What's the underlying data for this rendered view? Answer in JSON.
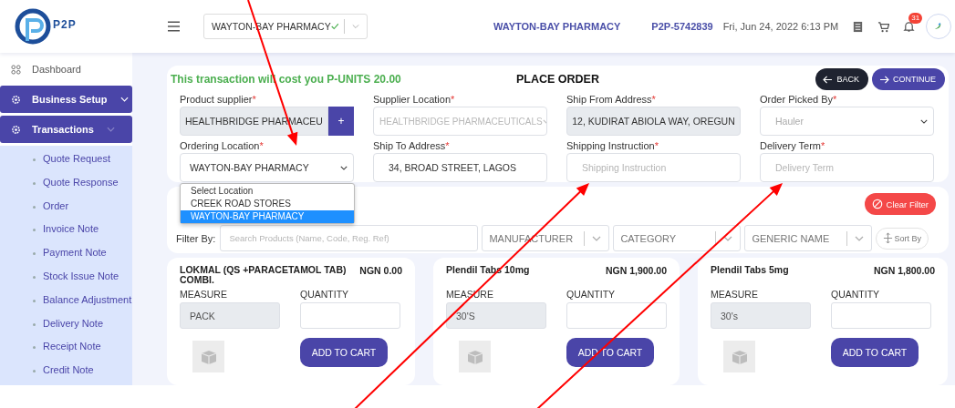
{
  "header": {
    "logo_text": "P2P",
    "store_select": {
      "value": "WAYTON-BAY PHARMACY",
      "verified": true
    },
    "org_name": "WAYTON-BAY PHARMACY",
    "account_id": "P2P-5742839",
    "datetime": "Fri, Jun 24, 2022 6:13 PM",
    "notification_count": "31"
  },
  "sidebar": {
    "items": [
      {
        "kind": "link",
        "label": "Dashboard"
      },
      {
        "kind": "group",
        "label": "Business Setup",
        "expanded": false
      },
      {
        "kind": "group",
        "label": "Transactions",
        "expanded": true,
        "children": [
          {
            "label": "Quote Request"
          },
          {
            "label": "Quote Response"
          },
          {
            "label": "Order"
          },
          {
            "label": "Invoice Note"
          },
          {
            "label": "Payment Note"
          },
          {
            "label": "Stock Issue Note"
          },
          {
            "label": "Balance Adjustment"
          },
          {
            "label": "Delivery Note"
          },
          {
            "label": "Receipt Note"
          },
          {
            "label": "Credit Note"
          }
        ]
      }
    ]
  },
  "order_form": {
    "required_mark": "*",
    "cost_notice": "This transaction will cost you P-UNITS 20.00",
    "title": "PLACE ORDER",
    "buttons": [
      {
        "kind": "back",
        "label": "BACK"
      },
      {
        "kind": "continue",
        "label": "CONTINUE"
      }
    ],
    "fields": [
      {
        "label": "Product supplier",
        "required": true,
        "kind": "readonly",
        "value": "HEALTHBRIDGE PHARMACEU",
        "add_button": "+"
      },
      {
        "label": "Supplier Location",
        "required": true,
        "kind": "select",
        "value": "HEALTHBRIDGE PHARMACEUTICALS",
        "disabled": true
      },
      {
        "label": "Ship From Address",
        "required": true,
        "kind": "readonly",
        "value": "12, KUDIRAT ABIOLA WAY, OREGUN"
      },
      {
        "label": "Order Picked By",
        "required": true,
        "kind": "select",
        "placeholder": "Hauler",
        "disabled": false
      },
      {
        "label": "Ordering Location",
        "required": true,
        "kind": "select",
        "value": "WAYTON-BAY PHARMACY",
        "disabled": false,
        "expanded": true,
        "options": [
          {
            "label": "Select Location",
            "selected": false
          },
          {
            "label": "CREEK ROAD STORES",
            "selected": false
          },
          {
            "label": "WAYTON-BAY PHARMACY",
            "selected": true
          }
        ]
      },
      {
        "label": "Ship To Address",
        "required": true,
        "kind": "input",
        "value": "34, BROAD STREET, LAGOS"
      },
      {
        "label": "Shipping Instruction",
        "required": true,
        "kind": "input",
        "placeholder": "Shipping Instruction"
      },
      {
        "label": "Delivery Term",
        "required": true,
        "kind": "input",
        "placeholder": "Delivery Term"
      }
    ]
  },
  "filters": {
    "clear_button": "Clear Filter",
    "label": "Filter By:",
    "search_placeholder": "Search Products (Name, Code, Reg. Ref)",
    "selects": [
      {
        "placeholder": "MANUFACTURER"
      },
      {
        "placeholder": "CATEGORY"
      },
      {
        "placeholder": "GENERIC NAME"
      }
    ],
    "sort_button": "Sort By"
  },
  "products": [
    {
      "name": "LOKMAL (QS +PARACETAMOL TAB) COMBI.",
      "price": "NGN 0.00",
      "measure_label": "MEASURE",
      "measure": "PACK",
      "quantity_label": "QUANTITY",
      "button": "ADD TO CART"
    },
    {
      "name": "Plendil Tabs 10mg",
      "price": "NGN 1,900.00",
      "measure_label": "MEASURE",
      "measure": "30'S",
      "quantity_label": "QUANTITY",
      "button": "ADD TO CART"
    },
    {
      "name": "Plendil Tabs 5mg",
      "price": "NGN 1,800.00",
      "measure_label": "MEASURE",
      "measure": "30's",
      "quantity_label": "QUANTITY",
      "button": "ADD TO CART"
    }
  ]
}
